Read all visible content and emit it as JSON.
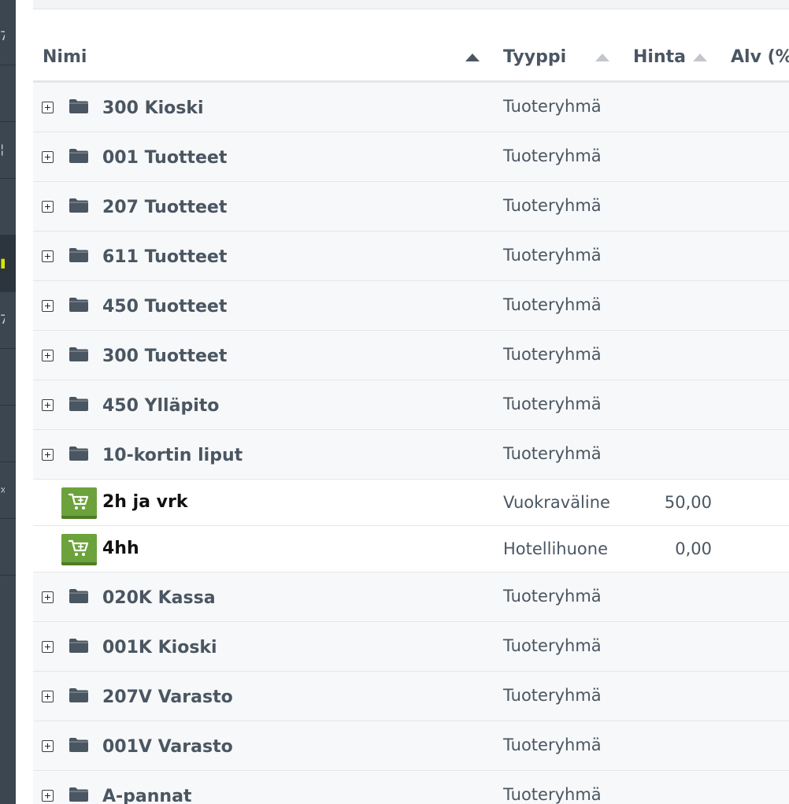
{
  "sidebar": {
    "items": [
      {
        "glyph": "7",
        "active": false
      },
      {
        "glyph": "",
        "active": false
      },
      {
        "glyph": "¦",
        "active": false
      },
      {
        "glyph": "",
        "active": false
      },
      {
        "glyph": "■",
        "active": true
      },
      {
        "glyph": "7",
        "active": false
      },
      {
        "glyph": "",
        "active": false
      },
      {
        "glyph": "",
        "active": false
      },
      {
        "glyph": "»",
        "active": false
      },
      {
        "glyph": "",
        "active": false
      }
    ]
  },
  "table": {
    "columns": {
      "name": "Nimi",
      "type": "Tyyppi",
      "price": "Hinta",
      "vat": "Alv (%"
    },
    "rows": [
      {
        "kind": "group",
        "name": "300 Kioski",
        "type": "Tuoteryhmä",
        "price": ""
      },
      {
        "kind": "group",
        "name": "001 Tuotteet",
        "type": "Tuoteryhmä",
        "price": ""
      },
      {
        "kind": "group",
        "name": "207 Tuotteet",
        "type": "Tuoteryhmä",
        "price": ""
      },
      {
        "kind": "group",
        "name": "611 Tuotteet",
        "type": "Tuoteryhmä",
        "price": ""
      },
      {
        "kind": "group",
        "name": "450 Tuotteet",
        "type": "Tuoteryhmä",
        "price": ""
      },
      {
        "kind": "group",
        "name": "300 Tuotteet",
        "type": "Tuoteryhmä",
        "price": ""
      },
      {
        "kind": "group",
        "name": "450 Ylläpito",
        "type": "Tuoteryhmä",
        "price": ""
      },
      {
        "kind": "group",
        "name": "10-kortin liput",
        "type": "Tuoteryhmä",
        "price": ""
      },
      {
        "kind": "product",
        "name": "2h ja vrk",
        "type": "Vuokraväline",
        "price": "50,00"
      },
      {
        "kind": "product",
        "name": "4hh",
        "type": "Hotellihuone",
        "price": "0,00"
      },
      {
        "kind": "group",
        "name": "020K Kassa",
        "type": "Tuoteryhmä",
        "price": ""
      },
      {
        "kind": "group",
        "name": "001K Kioski",
        "type": "Tuoteryhmä",
        "price": ""
      },
      {
        "kind": "group",
        "name": "207V Varasto",
        "type": "Tuoteryhmä",
        "price": ""
      },
      {
        "kind": "group",
        "name": "001V Varasto",
        "type": "Tuoteryhmä",
        "price": ""
      },
      {
        "kind": "group",
        "name": "A-pannat",
        "type": "Tuoteryhmä",
        "price": ""
      }
    ]
  },
  "colors": {
    "sidebar": "#3b4651",
    "text": "#4a5662",
    "cart_green": "#6ca23c",
    "row_alt": "#f7f8f9"
  },
  "icons": {
    "expand": "plus-square-icon",
    "group": "folder-icon",
    "product": "add-to-cart-icon",
    "sort": "sort-arrow-icon"
  }
}
